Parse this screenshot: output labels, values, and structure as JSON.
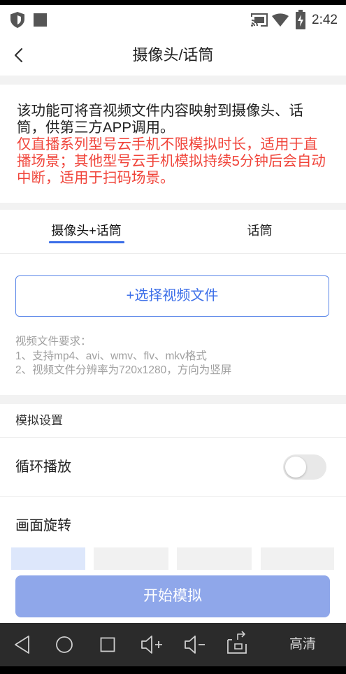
{
  "status_bar": {
    "time": "2:42",
    "left_icons": [
      "shield-icon",
      "square-icon"
    ],
    "right_icons": [
      "cast-icon",
      "wifi-icon",
      "battery-charging-icon"
    ]
  },
  "header": {
    "back_icon": "chevron-left-icon",
    "title": "摄像头/话筒"
  },
  "info": {
    "description": "该功能可将音视频文件内容映射到摄像头、话筒，供第三方APP调用。",
    "warning": "仅直播系列型号云手机不限模拟时长，适用于直播场景；其他型号云手机模拟持续5分钟后会自动中断，适用于扫码场景。"
  },
  "tabs": [
    {
      "label": "摄像头+话筒",
      "active": true
    },
    {
      "label": "话筒",
      "active": false
    }
  ],
  "select_video_button": {
    "label": "+选择视频文件"
  },
  "requirements": {
    "title": "视频文件要求：",
    "items": [
      "1、支持mp4、avi、wmv、flv、mkv格式",
      "2、视频文件分辨率为720x1280，方向为竖屏"
    ]
  },
  "settings": {
    "section_title": "模拟设置",
    "loop_playback": {
      "label": "循环播放",
      "enabled": false
    },
    "rotation": {
      "label": "画面旋转",
      "options": [
        {
          "selected": true
        },
        {
          "selected": false
        },
        {
          "selected": false
        },
        {
          "selected": false
        }
      ]
    }
  },
  "start_button": {
    "label": "开始模拟",
    "enabled": false
  },
  "nav_bar": {
    "icons": [
      "back-icon",
      "home-icon",
      "recents-icon",
      "volume-up-icon",
      "volume-down-icon",
      "screenshot-icon"
    ],
    "quality_label": "高清"
  },
  "colors": {
    "accent": "#3b6ee8",
    "warning": "#f0443a",
    "start_button_disabled": "#8fa7ea",
    "rotation_selected": "#dde7fb",
    "rotation_unselected": "#f1f1f1",
    "nav_bar": "#2b2b2b"
  }
}
